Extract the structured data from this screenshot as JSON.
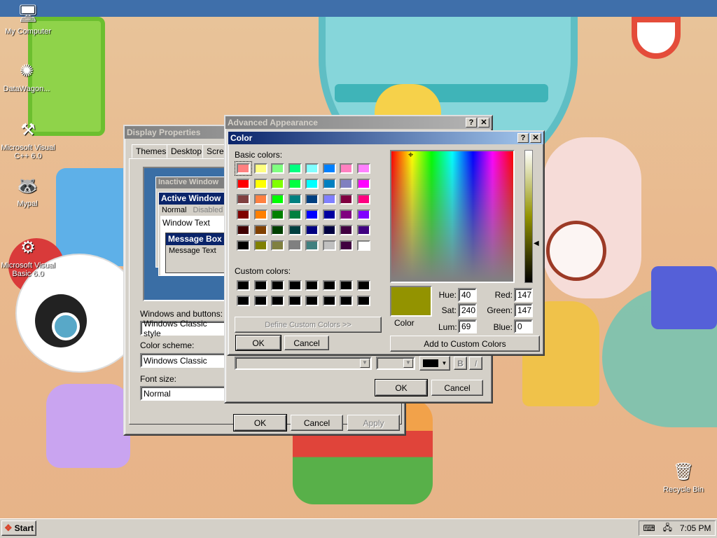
{
  "desktop": {
    "icons": [
      {
        "label": "My Computer",
        "icon": "my-computer-icon"
      },
      {
        "label": "DataWagon...",
        "icon": "datawagon-icon"
      },
      {
        "label": "Microsoft Visual C++ 6.0",
        "icon": "visual-cpp-icon"
      },
      {
        "label": "Mypal",
        "icon": "mypal-icon"
      },
      {
        "label": "Microsoft Visual Basic 6.0",
        "icon": "visual-basic-icon"
      },
      {
        "label": "Recycle Bin",
        "icon": "recycle-bin-icon"
      }
    ]
  },
  "display_properties": {
    "title": "Display Properties",
    "tabs": [
      "Themes",
      "Desktop",
      "Scree"
    ],
    "preview": {
      "inactive_window": "Inactive Window",
      "active_window": "Active Window",
      "normal": "Normal",
      "disabled": "Disabled",
      "window_text": "Window Text",
      "message_box": "Message Box",
      "message_text": "Message Text"
    },
    "windows_buttons_label": "Windows and buttons:",
    "windows_buttons_value": "Windows Classic style",
    "color_scheme_label": "Color scheme:",
    "color_scheme_value": "Windows Classic",
    "font_size_label": "Font size:",
    "font_size_value": "Normal",
    "ok": "OK",
    "cancel": "Cancel",
    "apply": "Apply"
  },
  "advanced_appearance": {
    "title": "Advanced Appearance",
    "bold_label": "B",
    "italic_label": "I",
    "ok": "OK",
    "cancel": "Cancel"
  },
  "color_dialog": {
    "title": "Color",
    "basic_colors_label": "Basic colors:",
    "custom_colors_label": "Custom colors:",
    "define_custom": "Define Custom Colors >>",
    "ok": "OK",
    "cancel": "Cancel",
    "color_label": "Color",
    "hue_label": "Hue:",
    "sat_label": "Sat:",
    "lum_label": "Lum:",
    "red_label": "Red:",
    "green_label": "Green:",
    "blue_label": "Blue:",
    "hue": "40",
    "sat": "240",
    "lum": "69",
    "red": "147",
    "green": "147",
    "blue": "0",
    "add_custom": "Add to Custom Colors",
    "selected_color": "#939300",
    "basic_colors": [
      "#ff8080",
      "#ffff80",
      "#80ff80",
      "#00ff80",
      "#80ffff",
      "#0080ff",
      "#ff80c0",
      "#ff80ff",
      "#ff0000",
      "#ffff00",
      "#80ff00",
      "#00ff40",
      "#00ffff",
      "#0080c0",
      "#8080c0",
      "#ff00ff",
      "#804040",
      "#ff8040",
      "#00ff00",
      "#008080",
      "#004080",
      "#8080ff",
      "#800040",
      "#ff0080",
      "#800000",
      "#ff8000",
      "#008000",
      "#008040",
      "#0000ff",
      "#0000a0",
      "#800080",
      "#8000ff",
      "#400000",
      "#804000",
      "#004000",
      "#004040",
      "#000080",
      "#000040",
      "#400040",
      "#400080",
      "#000000",
      "#808000",
      "#808040",
      "#808080",
      "#408080",
      "#c0c0c0",
      "#400040",
      "#ffffff"
    ],
    "custom_colors": [
      "#000000",
      "#000000",
      "#000000",
      "#000000",
      "#000000",
      "#000000",
      "#000000",
      "#000000",
      "#000000",
      "#000000",
      "#000000",
      "#000000",
      "#000000",
      "#000000",
      "#000000",
      "#000000"
    ]
  },
  "taskbar": {
    "start": "Start",
    "clock": "7:05 PM"
  }
}
